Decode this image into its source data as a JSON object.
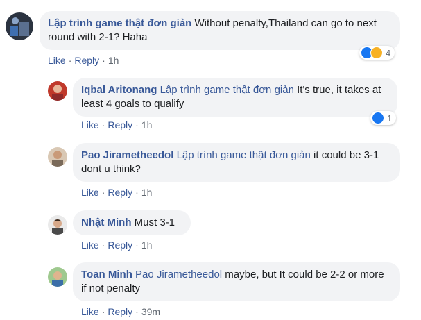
{
  "comments": [
    {
      "author": "Lập trình game thật đơn giản",
      "mention": "",
      "text": " Without penalty,Thailand can go to next round with 2-1? Haha",
      "actions": {
        "like": "Like",
        "reply": "Reply",
        "time": "1h"
      },
      "reactions": {
        "icons": [
          "like-icon",
          "haha-icon"
        ],
        "count": "4"
      }
    },
    {
      "author": "Iqbal Aritonang",
      "mention": "Lập trình game thật đơn giản",
      "text": " It's true, it takes at least 4 goals to qualify",
      "actions": {
        "like": "Like",
        "reply": "Reply",
        "time": "1h"
      },
      "reactions": {
        "icons": [
          "like-icon"
        ],
        "count": "1"
      }
    },
    {
      "author": "Pao Jirametheedol",
      "mention": "Lập trình game thật đơn giản",
      "text": " it could be 3-1 dont u think?",
      "actions": {
        "like": "Like",
        "reply": "Reply",
        "time": "1h"
      }
    },
    {
      "author": "Nhật Minh",
      "mention": "",
      "text": " Must 3-1",
      "actions": {
        "like": "Like",
        "reply": "Reply",
        "time": "1h"
      }
    },
    {
      "author": "Toan Minh",
      "mention": "Pao Jirametheedol",
      "text": " maybe, but It could be 2-2 or more if not penalty",
      "actions": {
        "like": "Like",
        "reply": "Reply",
        "time": "39m"
      }
    }
  ],
  "colors": {
    "link": "#385898",
    "bubble": "#f2f3f5",
    "meta": "#606770",
    "like_blue": "#1877f2"
  }
}
